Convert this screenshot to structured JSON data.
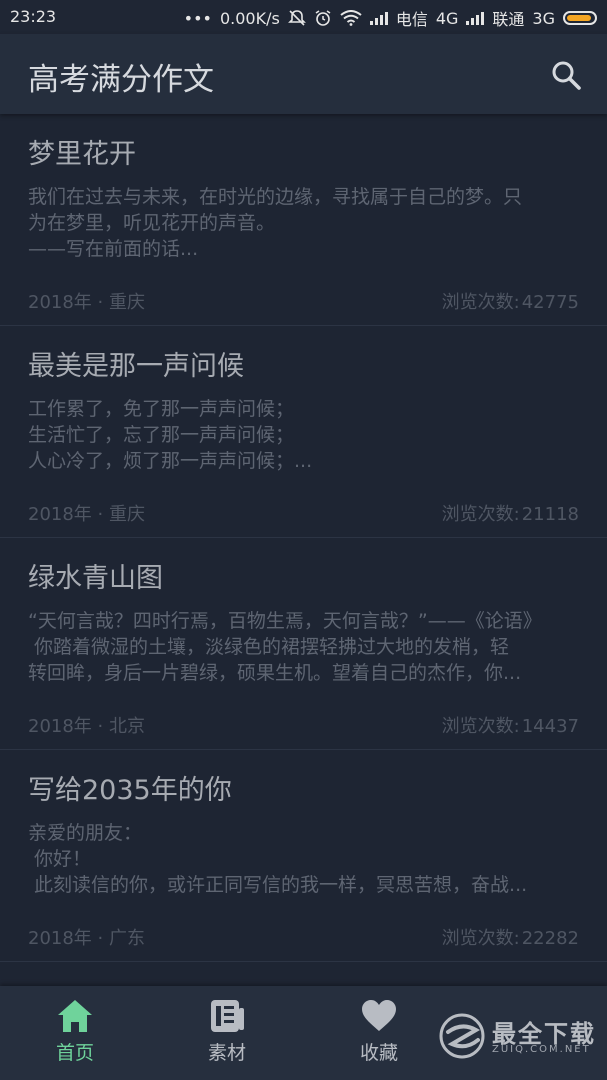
{
  "status_bar": {
    "time": "23:23",
    "dots": "•••",
    "speed": "0.00K/s",
    "carrier1": "电信",
    "net1": "4G",
    "carrier2": "联通",
    "net2": "3G",
    "battery_color": "#f5a623"
  },
  "app_bar": {
    "title": "高考满分作文",
    "search_icon": "search-icon"
  },
  "essays": [
    {
      "title": "梦里花开",
      "excerpt": "我们在过去与未来，在时光的边缘，寻找属于自己的梦。只\n为在梦里，听见花开的声音。\n——写在前面的话...",
      "meta": "2018年 · 重庆",
      "views_label": "浏览次数:",
      "views": "42775"
    },
    {
      "title": "最美是那一声问候",
      "excerpt": "工作累了，免了那一声声问候；\n生活忙了，忘了那一声声问候；\n人心冷了，烦了那一声声问候；...",
      "meta": "2018年 · 重庆",
      "views_label": "浏览次数:",
      "views": "21118"
    },
    {
      "title": "绿水青山图",
      "excerpt": "“天何言哉？四时行焉，百物生焉，天何言哉？”——《论语》\n 你踏着微湿的土壤，淡绿色的裙摆轻拂过大地的发梢，轻\n转回眸，身后一片碧绿，硕果生机。望着自己的杰作，你...",
      "meta": "2018年 · 北京",
      "views_label": "浏览次数:",
      "views": "14437"
    },
    {
      "title": "写给2035年的你",
      "excerpt": "亲爱的朋友：\n 你好！\n 此刻读信的你，或许正同写信的我一样，冥思苦想，奋战...",
      "meta": "2018年 · 广东",
      "views_label": "浏览次数:",
      "views": "22282"
    }
  ],
  "bottom_nav": {
    "tabs": [
      {
        "label": "首页",
        "icon": "home-icon",
        "active": true
      },
      {
        "label": "素材",
        "icon": "news-icon",
        "active": false
      },
      {
        "label": "收藏",
        "icon": "heart-icon",
        "active": false
      }
    ],
    "active_color": "#6fd39b"
  },
  "watermark": {
    "text": "最全下载",
    "url": "ZUIQ.COM.NET"
  }
}
